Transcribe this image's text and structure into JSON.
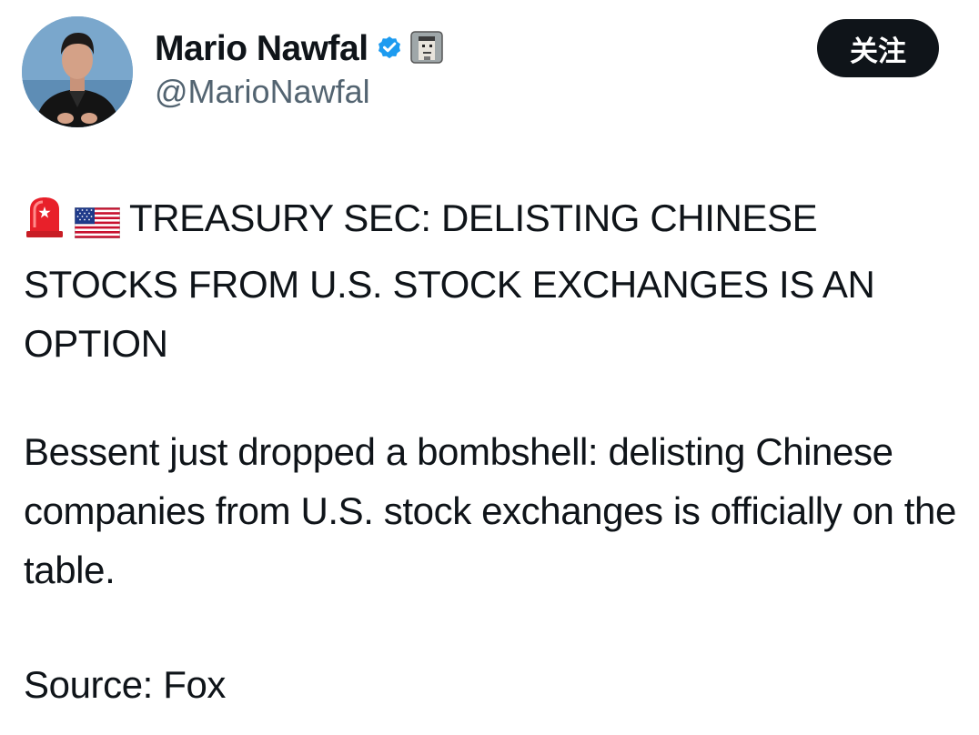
{
  "author": {
    "display_name": "Mario Nawfal",
    "handle": "@MarioNawfal",
    "verified_icon": "blue-check-badge",
    "affiliate_icon": "pixel-avatar-badge"
  },
  "follow_button": {
    "label": "关注"
  },
  "tweet": {
    "emoji_1": "police-light-emoji",
    "emoji_2": "us-flag-emoji",
    "headline": "TREASURY SEC: DELISTING CHINESE STOCKS FROM U.S. STOCK EXCHANGES IS AN OPTION",
    "body": "Bessent just dropped a bombshell: delisting Chinese companies from U.S. stock exchanges is officially on the table.",
    "source": "Source: Fox"
  },
  "colors": {
    "text_primary": "#0f1419",
    "text_secondary": "#536471",
    "verified_blue": "#1d9bf0",
    "button_bg": "#0f1419"
  }
}
